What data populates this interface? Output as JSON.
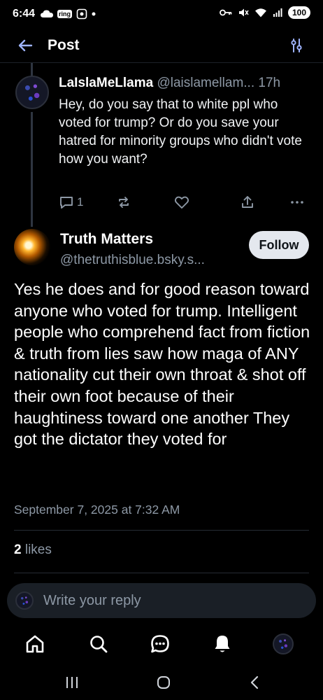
{
  "status_bar": {
    "time": "6:44",
    "chip_label": "ring",
    "battery": "100"
  },
  "header": {
    "title": "Post"
  },
  "parent_post": {
    "author_name": "LaIslaMeLlama",
    "author_handle": "@laislamellam...",
    "age": "17h",
    "text": "Hey, do you say that to white ppl who voted for trump? Or do you save your hatred for minority groups who didn't vote how you want?",
    "reply_count": "1"
  },
  "main_post": {
    "author_name": "Truth Matters",
    "author_handle": "@thetruthisblue.bsky.s...",
    "follow_label": "Follow",
    "text": "Yes he does and for good reason toward anyone who voted for trump. Intelligent people who comprehend fact from fiction & truth from lies saw how maga of ANY nationality cut their own throat & shot off their own foot because of their haughtiness toward one another They got the dictator they voted for",
    "timestamp": "September 7, 2025 at 7:32 AM",
    "likes_count": "2",
    "likes_label": "likes"
  },
  "reply_box": {
    "placeholder": "Write your reply"
  },
  "colors": {
    "background": "#000000",
    "secondary_text": "#8d98a5",
    "follow_bg": "#e4e8ee",
    "reply_bg": "#1a1f26"
  },
  "icons": {
    "back": "arrow-left-icon",
    "settings": "sliders-icon",
    "reply": "speech-bubble-icon",
    "repost": "repost-icon",
    "like": "heart-icon",
    "share": "share-icon",
    "more": "ellipsis-icon",
    "nav": [
      "home-icon",
      "search-icon",
      "chat-icon",
      "bell-icon",
      "profile-avatar"
    ]
  }
}
